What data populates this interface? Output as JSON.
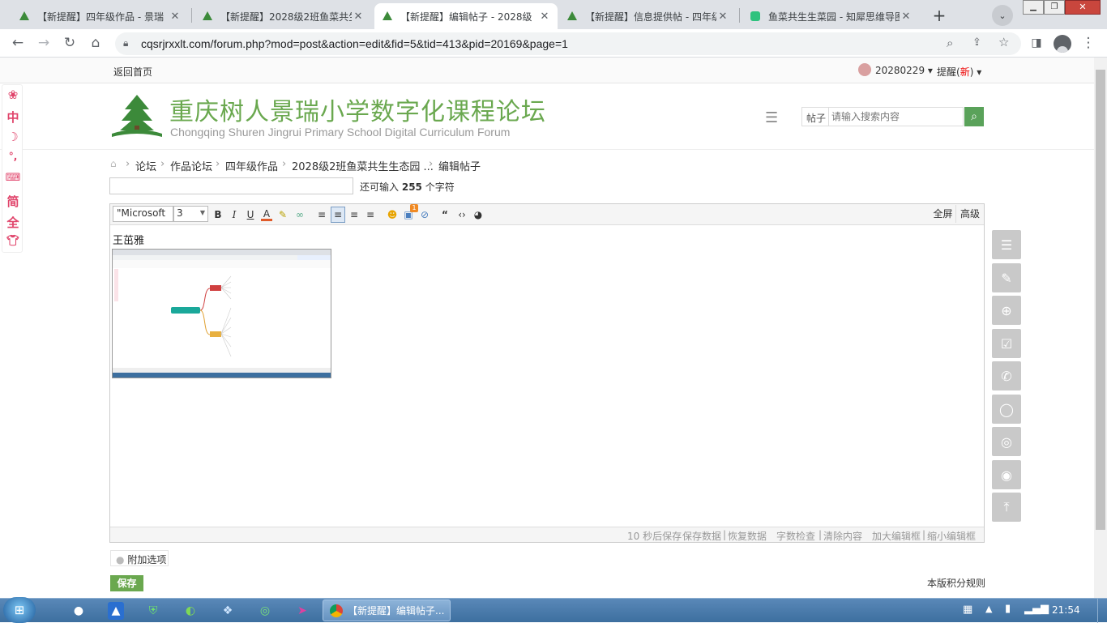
{
  "browser": {
    "tabs": [
      {
        "title": "【新提醒】四年级作品 - 景瑞",
        "active": false
      },
      {
        "title": "【新提醒】2028级2班鱼菜共生",
        "active": false
      },
      {
        "title": "【新提醒】编辑帖子 - 2028级",
        "active": true
      },
      {
        "title": "【新提醒】信息提供帖 - 四年级",
        "active": false
      },
      {
        "title": "鱼菜共生生菜园 - 知犀思维导图",
        "active": false
      }
    ],
    "url": "cqsrjrxxlt.com/forum.php?mod=post&action=edit&fid=5&tid=413&pid=20169&page=1"
  },
  "topnav": {
    "home_link": "返回首页",
    "username": "20280229",
    "remind": "提醒",
    "remind_new": "新"
  },
  "header": {
    "logo_cn": "重庆树人景瑞小学数字化课程论坛",
    "logo_en": "Chongqing Shuren Jingrui Primary School Digital Curriculum Forum",
    "search_type": "帖子",
    "search_placeholder": "请输入搜索内容"
  },
  "leftbar": [
    "中",
    "简",
    "全"
  ],
  "breadcrumb": [
    "论坛",
    "作品论坛",
    "四年级作品",
    "2028级2班鱼菜共生生态园 ...",
    "编辑帖子"
  ],
  "title_field": {
    "value": "",
    "hint_prefix": "还可输入",
    "hint_count": "255",
    "hint_suffix": "个字符"
  },
  "editor": {
    "font": "\"Microsoft",
    "size": "3",
    "fullscreen": "全屏",
    "advanced": "高级",
    "content_text": "王茁雅",
    "image_badge": "1",
    "footer": {
      "autosave": "10 秒后保存",
      "save_data": "保存数据",
      "restore_data": "恢复数据",
      "word_check": "字数检查",
      "clear": "清除内容",
      "enlarge": "加大编辑框",
      "shrink": "缩小编辑框"
    }
  },
  "extra_options": "附加选项",
  "save_button": "保存",
  "rules_link": "本版积分规则",
  "taskbar": {
    "active_window": "【新提醒】编辑帖子...",
    "time": "21:54"
  },
  "colors": {
    "brand_green": "#6aa84f",
    "logo_green": "#3c8a3a",
    "search_btn": "#5aa25a",
    "save_btn": "#6aa84f",
    "pink_icons": "#e0436a"
  }
}
